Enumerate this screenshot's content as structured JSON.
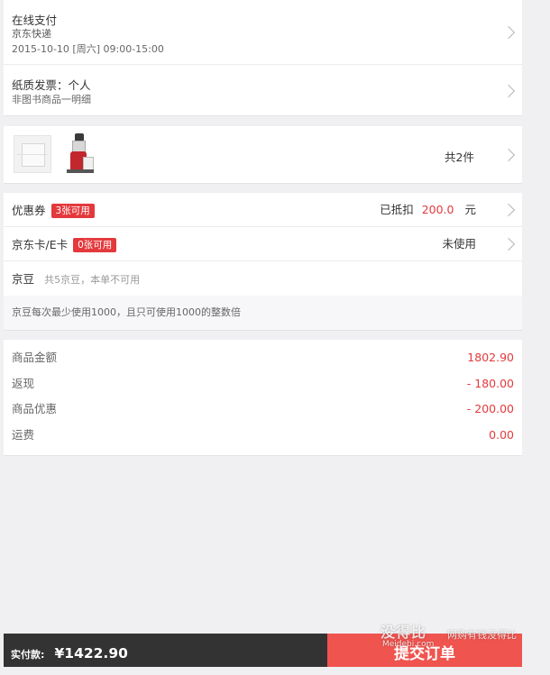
{
  "delivery": {
    "payment": "在线支付",
    "shipper": "京东快递",
    "time": "2015-10-10 [周六] 09:00-15:00"
  },
  "invoice": {
    "title": "纸质发票：个人",
    "detail": "非图书商品一明细"
  },
  "products": {
    "count_text": "共2件"
  },
  "benefits": {
    "coupon_label": "优惠券",
    "coupon_badge": "3张可用",
    "coupon_prefix": "已抵扣",
    "coupon_amount": "200.0",
    "coupon_unit": "元",
    "card_label": "京东卡/E卡",
    "card_badge": "0张可用",
    "card_status": "未使用",
    "bean_label": "京豆",
    "bean_note": "共5京豆，本单不可用",
    "bean_rule": "京豆每次最少使用1000，且只可使用1000的整数倍"
  },
  "summary": {
    "rows": [
      {
        "label": "商品金额",
        "value": "1802.90"
      },
      {
        "label": "返现",
        "value": "- 180.00"
      },
      {
        "label": "商品优惠",
        "value": "- 200.00"
      },
      {
        "label": "运费",
        "value": "0.00"
      }
    ]
  },
  "footer": {
    "total_label": "实付款:",
    "total_value": "¥1422.90",
    "submit_label": "提交订单"
  },
  "watermark": {
    "main": "没得比",
    "domain": "Meidebi.com",
    "tail": "网购有钱没得比"
  },
  "colors": {
    "accent": "#e4393c",
    "submit": "#f0544f",
    "footer_bg": "#333333"
  }
}
